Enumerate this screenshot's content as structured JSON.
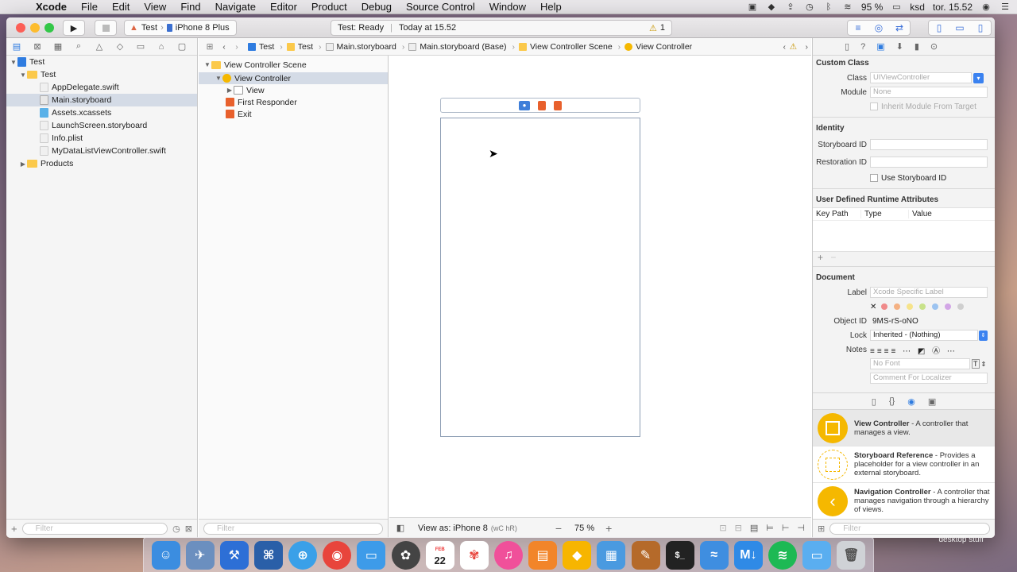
{
  "menubar": {
    "app": "Xcode",
    "items": [
      "File",
      "Edit",
      "View",
      "Find",
      "Navigate",
      "Editor",
      "Product",
      "Debug",
      "Source Control",
      "Window",
      "Help"
    ],
    "battery": "95 %",
    "user": "ksd",
    "clock": "tor. 15.52"
  },
  "toolbar": {
    "scheme_project": "Test",
    "scheme_device": "iPhone 8 Plus",
    "status_title": "Test: Ready",
    "status_time": "Today at 15.52",
    "warning_count": "1"
  },
  "navigator": {
    "items": [
      {
        "label": "Test",
        "kind": "project"
      },
      {
        "label": "Test",
        "kind": "folder"
      },
      {
        "label": "AppDelegate.swift",
        "kind": "swift"
      },
      {
        "label": "Main.storyboard",
        "kind": "storyboard"
      },
      {
        "label": "Assets.xcassets",
        "kind": "assets"
      },
      {
        "label": "LaunchScreen.storyboard",
        "kind": "storyboard"
      },
      {
        "label": "Info.plist",
        "kind": "plist"
      },
      {
        "label": "MyDataListViewController.swift",
        "kind": "swift"
      },
      {
        "label": "Products",
        "kind": "folder"
      }
    ],
    "filter_placeholder": "Filter"
  },
  "jumpbar": {
    "crumbs": [
      "Test",
      "Test",
      "Main.storyboard",
      "Main.storyboard (Base)",
      "View Controller Scene",
      "View Controller"
    ]
  },
  "outline": {
    "scene": "View Controller Scene",
    "controller": "View Controller",
    "view": "View",
    "first_responder": "First Responder",
    "exit": "Exit",
    "filter_placeholder": "Filter"
  },
  "canvas": {
    "view_as": "View as: iPhone 8",
    "size_class": "(wC hR)",
    "zoom": "75 %"
  },
  "inspector": {
    "custom_class": {
      "title": "Custom Class",
      "class_label": "Class",
      "class_placeholder": "UIViewController",
      "module_label": "Module",
      "module_placeholder": "None",
      "inherit_label": "Inherit Module From Target"
    },
    "identity": {
      "title": "Identity",
      "storyboard_id_label": "Storyboard ID",
      "restoration_id_label": "Restoration ID",
      "use_storyboard_id_label": "Use Storyboard ID"
    },
    "runtime": {
      "title": "User Defined Runtime Attributes",
      "col_key": "Key Path",
      "col_type": "Type",
      "col_value": "Value"
    },
    "document": {
      "title": "Document",
      "label_label": "Label",
      "label_placeholder": "Xcode Specific Label",
      "object_id_label": "Object ID",
      "object_id": "9MS-rS-oNO",
      "lock_label": "Lock",
      "lock_value": "Inherited - (Nothing)",
      "notes_label": "Notes",
      "font_placeholder": "No Font",
      "comment_placeholder": "Comment For Localizer",
      "label_colors": [
        "#f08a8a",
        "#f4b183",
        "#f6e38a",
        "#c8e28a",
        "#9cc3f0",
        "#d2a6e6",
        "#cfcfcf"
      ]
    },
    "library": [
      {
        "title": "View Controller",
        "desc": " - A controller that manages a view."
      },
      {
        "title": "Storyboard Reference",
        "desc": " - Provides a placeholder for a view controller in an external storyboard."
      },
      {
        "title": "Navigation Controller",
        "desc": " - A controller that manages navigation through a hierarchy of views."
      }
    ],
    "filter_placeholder": "Filter"
  },
  "dock": {
    "desktop_label": "desktop stuff",
    "calendar_month": "FEB",
    "calendar_day": "22"
  }
}
